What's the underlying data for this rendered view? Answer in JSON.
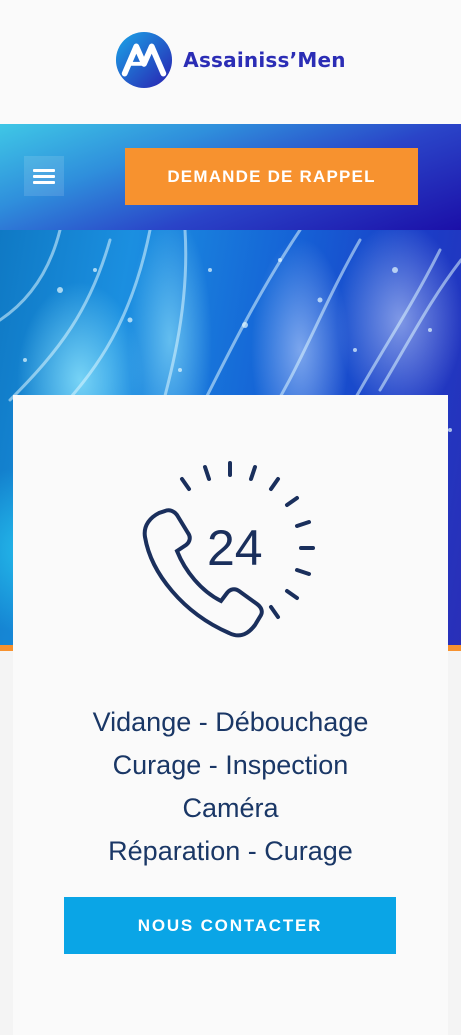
{
  "header": {
    "brand_name": "Assainiss’Men",
    "logo_icon": "am-logo-icon",
    "brand_color": "#2b2db5"
  },
  "navbar": {
    "menu_icon": "hamburger-icon",
    "callback_label": "DEMANDE DE RAPPEL",
    "callback_color": "#f7922f"
  },
  "hero": {
    "image": "water-splash-image",
    "accent_color": "#f7922f"
  },
  "card": {
    "icon": "phone-24h-icon",
    "icon_text": "24",
    "services": [
      "Vidange - Débouchage",
      "Curage - Inspection",
      "Caméra",
      "Réparation - Curage"
    ],
    "contact_label": "NOUS CONTACTER",
    "contact_color": "#0aa5e6",
    "text_color": "#1a3766"
  }
}
